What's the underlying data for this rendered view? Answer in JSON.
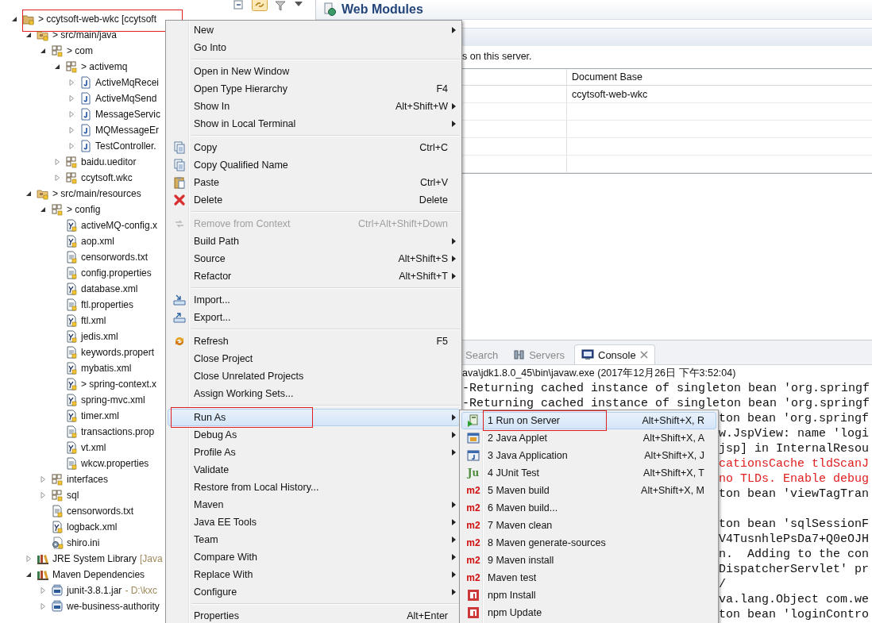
{
  "tree": [
    {
      "label": "> ccytsoft-web-wkc [ccytsoft",
      "kind": "project",
      "expanded": true,
      "marked": true,
      "children": [
        {
          "label": "> src/main/java",
          "kind": "source-folder",
          "expanded": true,
          "children": [
            {
              "label": "> com",
              "kind": "package",
              "expanded": true,
              "children": [
                {
                  "label": "> activemq",
                  "kind": "package",
                  "expanded": true,
                  "children": [
                    {
                      "label": "ActiveMqRecei",
                      "kind": "java",
                      "expanded": false
                    },
                    {
                      "label": "ActiveMqSend",
                      "kind": "java",
                      "expanded": false
                    },
                    {
                      "label": "MessageServic",
                      "kind": "java",
                      "expanded": false
                    },
                    {
                      "label": "MQMessageEr",
                      "kind": "java",
                      "expanded": false
                    },
                    {
                      "label": "TestController.",
                      "kind": "java",
                      "expanded": false
                    }
                  ]
                },
                {
                  "label": "baidu.ueditor",
                  "kind": "package",
                  "expanded": false
                },
                {
                  "label": "ccytsoft.wkc",
                  "kind": "package",
                  "expanded": false
                }
              ]
            }
          ]
        },
        {
          "label": "> src/main/resources",
          "kind": "source-folder",
          "expanded": true,
          "children": [
            {
              "label": "> config",
              "kind": "package",
              "expanded": true,
              "children": [
                {
                  "label": "activeMQ-config.x",
                  "kind": "xml"
                },
                {
                  "label": "aop.xml",
                  "kind": "xml"
                },
                {
                  "label": "censorwords.txt",
                  "kind": "text"
                },
                {
                  "label": "config.properties",
                  "kind": "text"
                },
                {
                  "label": "database.xml",
                  "kind": "xml"
                },
                {
                  "label": "ftl.properties",
                  "kind": "text"
                },
                {
                  "label": "ftl.xml",
                  "kind": "xml"
                },
                {
                  "label": "jedis.xml",
                  "kind": "xml"
                },
                {
                  "label": "keywords.propert",
                  "kind": "text"
                },
                {
                  "label": "mybatis.xml",
                  "kind": "xml"
                },
                {
                  "label": "> spring-context.x",
                  "kind": "xml"
                },
                {
                  "label": "spring-mvc.xml",
                  "kind": "xml"
                },
                {
                  "label": "timer.xml",
                  "kind": "xml"
                },
                {
                  "label": "transactions.prop",
                  "kind": "text"
                },
                {
                  "label": "vt.xml",
                  "kind": "xml"
                },
                {
                  "label": "wkcw.properties",
                  "kind": "text"
                }
              ]
            },
            {
              "label": "interfaces",
              "kind": "package",
              "expanded": false
            },
            {
              "label": "sql",
              "kind": "package",
              "expanded": false
            },
            {
              "label": "censorwords.txt",
              "kind": "text"
            },
            {
              "label": "logback.xml",
              "kind": "xml"
            },
            {
              "label": "shiro.ini",
              "kind": "ini"
            }
          ]
        },
        {
          "label": "JRE System Library",
          "decoration": "[Java",
          "kind": "library",
          "expanded": false
        },
        {
          "label": "Maven Dependencies",
          "kind": "library",
          "expanded": true,
          "children": [
            {
              "label": "junit-3.8.1.jar",
              "decoration": "- D:\\kxc",
              "kind": "jar",
              "expanded": false
            },
            {
              "label": "we-business-authority",
              "kind": "jar",
              "expanded": false
            }
          ]
        }
      ]
    }
  ],
  "editor": {
    "title": "Web Modules",
    "description": "s on this server.",
    "table": {
      "columns": [
        "Document Base"
      ],
      "rows": [
        {
          "document_base": "ccytsoft-web-wkc"
        }
      ]
    }
  },
  "console": {
    "tabs": [
      {
        "label": "Search",
        "kind": "plain",
        "selected": false,
        "closable": false
      },
      {
        "label": "Servers",
        "kind": "servers",
        "selected": false,
        "closable": false
      },
      {
        "label": "Console",
        "kind": "console",
        "selected": true,
        "closable": true
      }
    ],
    "process": "ava\\jdk1.8.0_45\\bin\\javaw.exe (2017年12月26日 下午3:52:04)",
    "lines": [
      {
        "text": "-Returning cached instance of singleton bean 'org.springf",
        "kind": "info"
      },
      {
        "text": "-Returning cached instance of singleton bean 'org.springf",
        "kind": "info"
      },
      {
        "text": "ton bean 'org.springf",
        "kind": "info"
      },
      {
        "text": "w.JspView: name 'logi",
        "kind": "info"
      },
      {
        "text": "jsp] in InternalResou",
        "kind": "info"
      },
      {
        "text": "cationsCache tldScanJ",
        "kind": "error"
      },
      {
        "text": "no TLDs. Enable debug",
        "kind": "error"
      },
      {
        "text": "ton bean 'viewTagTran",
        "kind": "info"
      },
      {
        "kind": "blank"
      },
      {
        "text": "ton bean 'sqlSessionF",
        "kind": "info"
      },
      {
        "text": "V4TusnhlePsDa7+Q0eOJH",
        "kind": "info"
      },
      {
        "text": "n.  Adding to the con",
        "kind": "info"
      },
      {
        "text": "DispatcherServlet' pr",
        "kind": "info"
      },
      {
        "text": "/",
        "kind": "info"
      },
      {
        "text": "va.lang.Object com.we",
        "kind": "info"
      },
      {
        "text": "ton bean 'loginContro",
        "kind": "info"
      }
    ]
  },
  "context_menu": {
    "items": [
      {
        "kind": "plain",
        "label": "New",
        "submenu": true,
        "selected": false
      },
      {
        "kind": "plain",
        "label": "Go Into",
        "selected": false
      },
      {
        "kind": "separator"
      },
      {
        "kind": "plain",
        "label": "Open in New Window",
        "selected": false
      },
      {
        "kind": "plain",
        "label": "Open Type Hierarchy",
        "shortcut": "F4",
        "selected": false
      },
      {
        "kind": "plain",
        "label": "Show In",
        "shortcut": "Alt+Shift+W",
        "submenu": true,
        "selected": false
      },
      {
        "kind": "plain",
        "label": "Show in Local Terminal",
        "submenu": true,
        "selected": false
      },
      {
        "kind": "separator"
      },
      {
        "kind": "copy",
        "label": "Copy",
        "shortcut": "Ctrl+C",
        "selected": false
      },
      {
        "kind": "copy-name",
        "label": "Copy Qualified Name",
        "selected": false
      },
      {
        "kind": "paste",
        "label": "Paste",
        "shortcut": "Ctrl+V",
        "selected": false
      },
      {
        "kind": "delete",
        "label": "Delete",
        "shortcut": "Delete",
        "selected": false
      },
      {
        "kind": "separator"
      },
      {
        "kind": "remove",
        "label": "Remove from Context",
        "shortcut": "Ctrl+Alt+Shift+Down",
        "disabled": true,
        "selected": false
      },
      {
        "kind": "plain",
        "label": "Build Path",
        "submenu": true,
        "selected": false
      },
      {
        "kind": "plain",
        "label": "Source",
        "shortcut": "Alt+Shift+S",
        "submenu": true,
        "selected": false
      },
      {
        "kind": "plain",
        "label": "Refactor",
        "shortcut": "Alt+Shift+T",
        "submenu": true,
        "selected": false
      },
      {
        "kind": "separator"
      },
      {
        "kind": "import",
        "label": "Import...",
        "selected": false
      },
      {
        "kind": "export",
        "label": "Export...",
        "selected": false
      },
      {
        "kind": "separator"
      },
      {
        "kind": "refresh",
        "label": "Refresh",
        "shortcut": "F5",
        "selected": false
      },
      {
        "kind": "plain",
        "label": "Close Project",
        "selected": false
      },
      {
        "kind": "plain",
        "label": "Close Unrelated Projects",
        "selected": false
      },
      {
        "kind": "plain",
        "label": "Assign Working Sets...",
        "selected": false
      },
      {
        "kind": "separator"
      },
      {
        "kind": "plain",
        "label": "Run As",
        "submenu": true,
        "selected": true,
        "marked": true
      },
      {
        "kind": "plain",
        "label": "Debug As",
        "submenu": true,
        "selected": false
      },
      {
        "kind": "plain",
        "label": "Profile As",
        "submenu": true,
        "selected": false
      },
      {
        "kind": "plain",
        "label": "Validate",
        "selected": false
      },
      {
        "kind": "plain",
        "label": "Restore from Local History...",
        "selected": false
      },
      {
        "kind": "plain",
        "label": "Maven",
        "submenu": true,
        "selected": false
      },
      {
        "kind": "plain",
        "label": "Java EE Tools",
        "submenu": true,
        "selected": false
      },
      {
        "kind": "plain",
        "label": "Team",
        "submenu": true,
        "selected": false
      },
      {
        "kind": "plain",
        "label": "Compare With",
        "submenu": true,
        "selected": false
      },
      {
        "kind": "plain",
        "label": "Replace With",
        "submenu": true,
        "selected": false
      },
      {
        "kind": "plain",
        "label": "Configure",
        "submenu": true,
        "selected": false
      },
      {
        "kind": "separator"
      },
      {
        "kind": "plain",
        "label": "Properties",
        "shortcut": "Alt+Enter",
        "selected": false
      }
    ]
  },
  "run_as_menu": {
    "items": [
      {
        "label": "1 Run on Server",
        "shortcut": "Alt+Shift+X, R",
        "kind": "run-server",
        "selected": true,
        "marked": true
      },
      {
        "label": "2 Java Applet",
        "shortcut": "Alt+Shift+X, A",
        "kind": "applet",
        "selected": false
      },
      {
        "label": "3 Java Application",
        "shortcut": "Alt+Shift+X, J",
        "kind": "application",
        "selected": false
      },
      {
        "label": "4 JUnit Test",
        "shortcut": "Alt+Shift+X, T",
        "kind": "junit",
        "badge": "Ju",
        "selected": false
      },
      {
        "label": "5 Maven build",
        "shortcut": "Alt+Shift+X, M",
        "kind": "maven",
        "badge": "m2",
        "selected": false
      },
      {
        "label": "6 Maven build...",
        "kind": "maven",
        "badge": "m2",
        "selected": false
      },
      {
        "label": "7 Maven clean",
        "kind": "maven",
        "badge": "m2",
        "selected": false
      },
      {
        "label": "8 Maven generate-sources",
        "kind": "maven",
        "badge": "m2",
        "selected": false
      },
      {
        "label": "9 Maven install",
        "kind": "maven",
        "badge": "m2",
        "selected": false
      },
      {
        "label": "Maven test",
        "kind": "maven",
        "badge": "m2",
        "selected": false
      },
      {
        "label": "npm Install",
        "kind": "npm",
        "selected": false
      },
      {
        "label": "npm Update",
        "kind": "npm",
        "selected": false
      }
    ]
  }
}
